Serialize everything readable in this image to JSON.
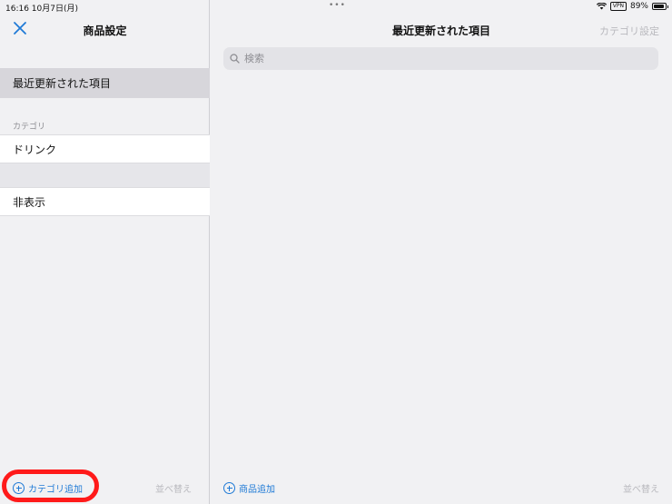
{
  "status_bar": {
    "time_date": "16:16   10月7日(月)",
    "dots": "•••",
    "vpn": "VPN",
    "battery": "89%"
  },
  "left_panel": {
    "title": "商品設定",
    "recent_item": "最近更新された項目",
    "category_section_label": "カテゴリ",
    "category_items": [
      "ドリンク"
    ],
    "hidden_item": "非表示",
    "add_category": "カテゴリ追加",
    "sort": "並べ替え"
  },
  "right_panel": {
    "title": "最近更新された項目",
    "category_settings": "カテゴリ設定",
    "search_placeholder": "検索",
    "add_product": "商品追加",
    "sort": "並べ替え"
  },
  "colors": {
    "accent": "#1f7ad6",
    "highlight": "#ff1a1a",
    "disabled": "#b9b9be"
  }
}
